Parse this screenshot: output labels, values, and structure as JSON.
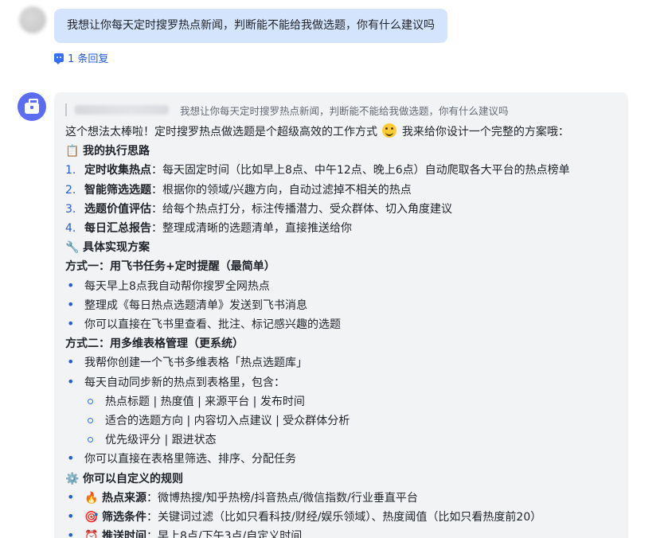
{
  "user_message": {
    "text": "我想让你每天定时搜罗热点新闻，判断能不能给我做选题，你有什么建议吗",
    "reply_count_label": "1 条回复"
  },
  "bot_message": {
    "quote_text": "我想让你每天定时搜罗热点新闻，判断能不能给我做选题，你有什么建议吗",
    "intro_a": "这个想法太棒啦！定时搜罗热点做选题是个超级高效的工作方式",
    "intro_b": "我来给你设计一个完整的方案哦：",
    "sections": {
      "thinking": {
        "icon": "📋",
        "title": "我的执行思路"
      },
      "implementation": {
        "icon": "🔧",
        "title": "具体实现方案"
      },
      "custom": {
        "icon": "⚙️",
        "title": "你可以自定义的规则"
      }
    },
    "steps": [
      {
        "n": "1.",
        "title": "定时收集热点",
        "text": "：每天固定时间（比如早上8点、中午12点、晚上6点）自动爬取各大平台的热点榜单"
      },
      {
        "n": "2.",
        "title": "智能筛选选题",
        "text": "：根据你的领域/兴趣方向，自动过滤掉不相关的热点"
      },
      {
        "n": "3.",
        "title": "选题价值评估",
        "text": "：给每个热点打分，标注传播潜力、受众群体、切入角度建议"
      },
      {
        "n": "4.",
        "title": "每日汇总报告",
        "text": "：整理成清晰的选题清单，直接推送给你"
      }
    ],
    "option1": {
      "title": "方式一：用飞书任务+定时提醒（最简单）",
      "items": [
        "每天早上8点我自动帮你搜罗全网热点",
        "整理成《每日热点选题清单》发送到飞书消息",
        "你可以直接在飞书里查看、批注、标记感兴趣的选题"
      ]
    },
    "option2": {
      "title": "方式二：用多维表格管理（更系统）",
      "items": [
        "我帮你创建一个飞书多维表格「热点选题库」",
        "每天自动同步新的热点到表格里，包含："
      ],
      "sub_items": [
        "热点标题 | 热度值 | 来源平台 | 发布时间",
        "适合的选题方向 | 内容切入点建议 | 受众群体分析",
        "优先级评分 | 跟进状态"
      ],
      "last_item": "你可以直接在表格里筛选、排序、分配任务"
    },
    "rules": [
      {
        "icon": "🔥",
        "title": "热点来源",
        "text": "：微博热搜/知乎热榜/抖音热点/微信指数/行业垂直平台"
      },
      {
        "icon": "🎯",
        "title": "筛选条件",
        "text": "：关键词过滤（比如只看科技/财经/娱乐领域）、热度阈值（比如只看热度前20）"
      },
      {
        "icon": "⏰",
        "title": "推送时间",
        "text": "：早上8点/下午3点/自定义时间"
      }
    ]
  },
  "colors": {
    "accent": "#245bdb",
    "user_bubble": "#d4e4fd",
    "bot_bubble": "#f2f3f5",
    "bot_avatar": "#5b6cf0"
  }
}
